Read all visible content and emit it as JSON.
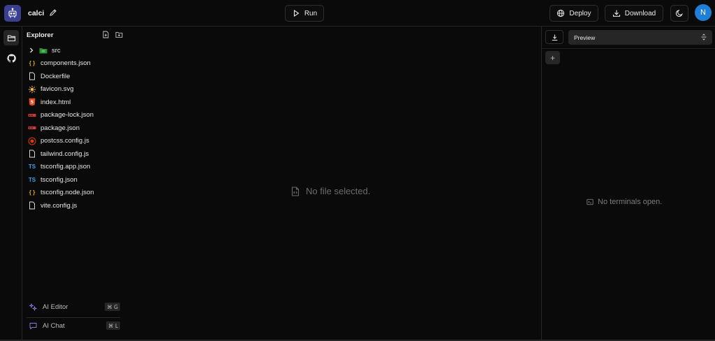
{
  "header": {
    "project_name": "calci",
    "run_label": "Run",
    "deploy_label": "Deploy",
    "download_label": "Download",
    "avatar_initial": "N",
    "avatar_color": "#1f7fd6"
  },
  "explorer": {
    "title": "Explorer",
    "items": [
      {
        "name": "src",
        "type": "folder",
        "icon": "folder-src-icon"
      },
      {
        "name": "components.json",
        "type": "file",
        "icon": "json-icon"
      },
      {
        "name": "Dockerfile",
        "type": "file",
        "icon": "file-icon"
      },
      {
        "name": "favicon.svg",
        "type": "file",
        "icon": "svg-icon"
      },
      {
        "name": "index.html",
        "type": "file",
        "icon": "html-icon"
      },
      {
        "name": "package-lock.json",
        "type": "file",
        "icon": "npm-icon"
      },
      {
        "name": "package.json",
        "type": "file",
        "icon": "npm-icon"
      },
      {
        "name": "postcss.config.js",
        "type": "file",
        "icon": "postcss-icon"
      },
      {
        "name": "tailwind.config.js",
        "type": "file",
        "icon": "file-icon"
      },
      {
        "name": "tsconfig.app.json",
        "type": "file",
        "icon": "typescript-icon"
      },
      {
        "name": "tsconfig.json",
        "type": "file",
        "icon": "typescript-icon"
      },
      {
        "name": "tsconfig.node.json",
        "type": "file",
        "icon": "json-icon"
      },
      {
        "name": "vite.config.js",
        "type": "file",
        "icon": "file-icon"
      }
    ]
  },
  "ai": {
    "editor_label": "AI Editor",
    "editor_shortcut": "⌘ G",
    "chat_label": "AI Chat",
    "chat_shortcut": "⌘ L"
  },
  "editor": {
    "empty_text": "No file selected."
  },
  "right_panel": {
    "preview_label": "Preview",
    "add_label": "+",
    "empty_text": "No terminals open."
  }
}
